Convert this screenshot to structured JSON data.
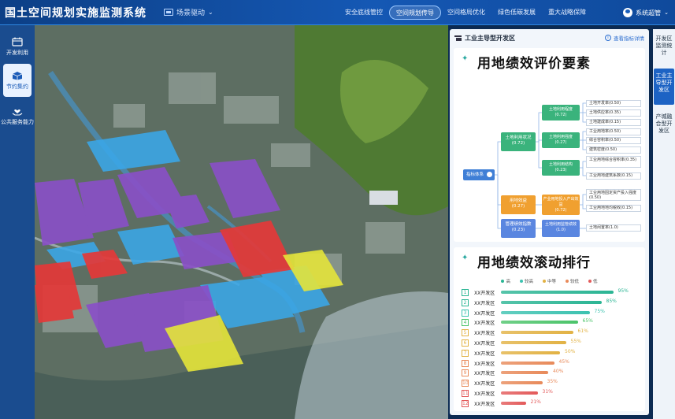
{
  "header": {
    "system_title": "国土空间规划实施监测系统",
    "scene_label": "场景驱动",
    "nav": [
      {
        "label": "安全底线管控",
        "active": false
      },
      {
        "label": "空间规划传导",
        "active": true
      },
      {
        "label": "空间格局优化",
        "active": false
      },
      {
        "label": "绿色低碳发展",
        "active": false
      },
      {
        "label": "重大战略保障",
        "active": false
      }
    ],
    "user_name": "系统超管"
  },
  "sidebar": {
    "items": [
      {
        "label": "开发利用",
        "icon": "calendar-icon",
        "active": false
      },
      {
        "label": "节约集约",
        "icon": "box-icon",
        "active": true
      },
      {
        "label": "公共服务能力",
        "icon": "hand-heart-icon",
        "active": false
      }
    ]
  },
  "panel": {
    "title": "工业主导型开发区",
    "detail_link": "查看指标详情",
    "tree_title": "用地绩效评价要素",
    "tree": {
      "root": "指标体系",
      "level1": [
        {
          "label": "土地利用状况",
          "value": "(0.72)"
        },
        {
          "label": "用地效益",
          "value": "(0.27)"
        },
        {
          "label": "管理绩效指数",
          "value": "(0.23)"
        }
      ],
      "level2": [
        {
          "label": "土地利用程度",
          "value": "(0.72)"
        },
        {
          "label": "土地利用强度",
          "value": "(0.27)"
        },
        {
          "label": "土地利用结构",
          "value": "(0.23)"
        },
        {
          "label": "产业用地投入产出效益",
          "value": "(0.72)"
        },
        {
          "label": "土地利用监管绩效",
          "value": "(1.0)"
        }
      ],
      "leaves": [
        "土地开发率(0.50)",
        "土地供应率(0.35)",
        "土地建成率(0.15)",
        "工业用地率(0.50)",
        "综合容积率(0.50)",
        "建筑密度(0.50)",
        "工业用地综合容积率(0.35)",
        "工业用地建筑系数(0.15)",
        "工业用地固定资产投入强度(0.50)",
        "工业用地地均税收(0.15)",
        "土地闲置率(1.0)"
      ]
    },
    "rank_title": "用地绩效滚动排行",
    "legend": [
      {
        "label": "高",
        "color": "#2bb594"
      },
      {
        "label": "较高",
        "color": "#3cc2b0"
      },
      {
        "label": "中等",
        "color": "#e2b244"
      },
      {
        "label": "较低",
        "color": "#e88a5a"
      },
      {
        "label": "低",
        "color": "#e35a5a"
      }
    ],
    "ranking": [
      {
        "rank": "1",
        "name": "XX开发区",
        "value": 95,
        "label": "95%",
        "color": "#2bb594"
      },
      {
        "rank": "2",
        "name": "XX开发区",
        "value": 85,
        "label": "85%",
        "color": "#2bb594"
      },
      {
        "rank": "3",
        "name": "XX开发区",
        "value": 75,
        "label": "75%",
        "color": "#3cc2b0"
      },
      {
        "rank": "4",
        "name": "XX开发区",
        "value": 65,
        "label": "65%",
        "color": "#4cc46a"
      },
      {
        "rank": "5",
        "name": "XX开发区",
        "value": 61,
        "label": "61%",
        "color": "#e2b244"
      },
      {
        "rank": "6",
        "name": "XX开发区",
        "value": 55,
        "label": "55%",
        "color": "#e2b244"
      },
      {
        "rank": "7",
        "name": "XX开发区",
        "value": 50,
        "label": "50%",
        "color": "#e2b244"
      },
      {
        "rank": "8",
        "name": "XX开发区",
        "value": 45,
        "label": "45%",
        "color": "#e88a5a"
      },
      {
        "rank": "9",
        "name": "XX开发区",
        "value": 40,
        "label": "40%",
        "color": "#e88a5a"
      },
      {
        "rank": "10",
        "name": "XX开发区",
        "value": 35,
        "label": "35%",
        "color": "#e88a5a"
      },
      {
        "rank": "11",
        "name": "XX开发区",
        "value": 31,
        "label": "31%",
        "color": "#e35a5a"
      },
      {
        "rank": "12",
        "name": "XX开发区",
        "value": 21,
        "label": "21%",
        "color": "#e35a5a"
      }
    ]
  },
  "right_tabs": [
    {
      "label": "开发区监测统计",
      "active": false
    },
    {
      "label": "工业主导型开发区",
      "active": true
    },
    {
      "label": "产城融合型开发区",
      "active": false
    }
  ],
  "colors": {
    "header": "#1558b4",
    "zone_blue": "#3aa7e8",
    "zone_purple": "#8a4fc8",
    "zone_red": "#e43838",
    "zone_yellow": "#e4e43a"
  }
}
